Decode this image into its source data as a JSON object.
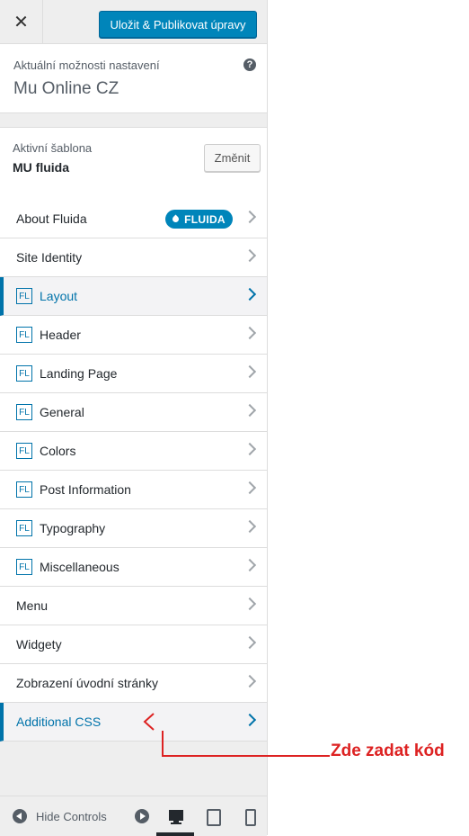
{
  "topbar": {
    "close_symbol": "✕",
    "save_label": "Uložit & Publikovat úpravy"
  },
  "site": {
    "label": "Aktuální možnosti nastavení",
    "help_symbol": "?",
    "name": "Mu Online CZ"
  },
  "theme": {
    "label": "Aktivní šablona",
    "name": "MU fluida",
    "change_label": "Změnit"
  },
  "menu": [
    {
      "label": "About Fluida",
      "badge": "FLUIDA"
    },
    {
      "label": "Site Identity"
    },
    {
      "label": "Layout",
      "fl": "FL",
      "active": true
    },
    {
      "label": "Header",
      "fl": "FL"
    },
    {
      "label": "Landing Page",
      "fl": "FL"
    },
    {
      "label": "General",
      "fl": "FL"
    },
    {
      "label": "Colors",
      "fl": "FL"
    },
    {
      "label": "Post Information",
      "fl": "FL"
    },
    {
      "label": "Typography",
      "fl": "FL"
    },
    {
      "label": "Miscellaneous",
      "fl": "FL"
    },
    {
      "label": "Menu"
    },
    {
      "label": "Widgety"
    },
    {
      "label": "Zobrazení úvodní stránky"
    },
    {
      "label": "Additional CSS",
      "active": true
    }
  ],
  "footer": {
    "hide_label": "Hide Controls"
  },
  "annotation": {
    "text": "Zde zadat kód",
    "color": "#dd2222"
  },
  "colors": {
    "accent": "#0073aa",
    "button": "#0085ba",
    "panel": "#eeeeee"
  }
}
